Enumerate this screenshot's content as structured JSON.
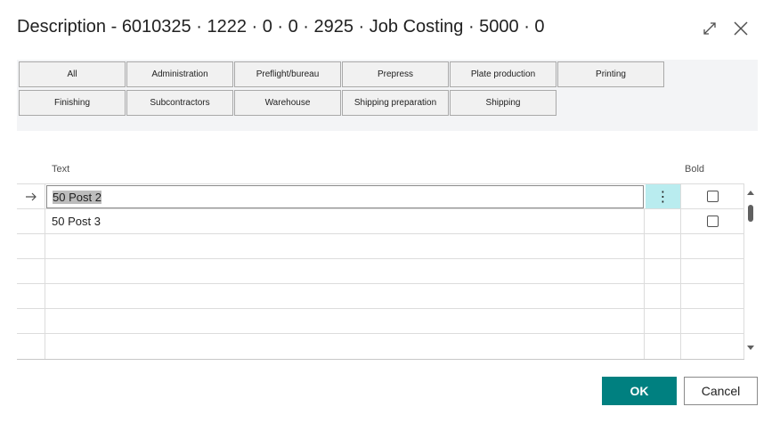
{
  "dialog": {
    "title": "Description - 6010325 · 1222 · 0 · 0 · 2925 · Job Costing · 5000 · 0",
    "expand_icon": "expand-icon",
    "close_icon": "close-icon"
  },
  "categories": {
    "row1": [
      "All",
      "Administration",
      "Preflight/bureau",
      "Prepress",
      "Plate production",
      "Printing"
    ],
    "row2": [
      "Finishing",
      "Subcontractors",
      "Warehouse",
      "Shipping preparation",
      "Shipping"
    ]
  },
  "grid": {
    "columns": {
      "text": "Text",
      "bold": "Bold"
    },
    "rows": [
      {
        "text": "50 Post 2",
        "bold": false,
        "selected": true
      },
      {
        "text": "50 Post 3",
        "bold": false,
        "selected": false
      },
      {
        "text": ""
      },
      {
        "text": ""
      },
      {
        "text": ""
      },
      {
        "text": ""
      },
      {
        "text": ""
      }
    ],
    "row_menu_icon": "more-vertical-icon",
    "current_row_icon": "arrow-right-icon"
  },
  "actions": {
    "ok": "OK",
    "cancel": "Cancel"
  },
  "colors": {
    "accent": "#008080",
    "row_menu_active": "#b9ecef"
  }
}
